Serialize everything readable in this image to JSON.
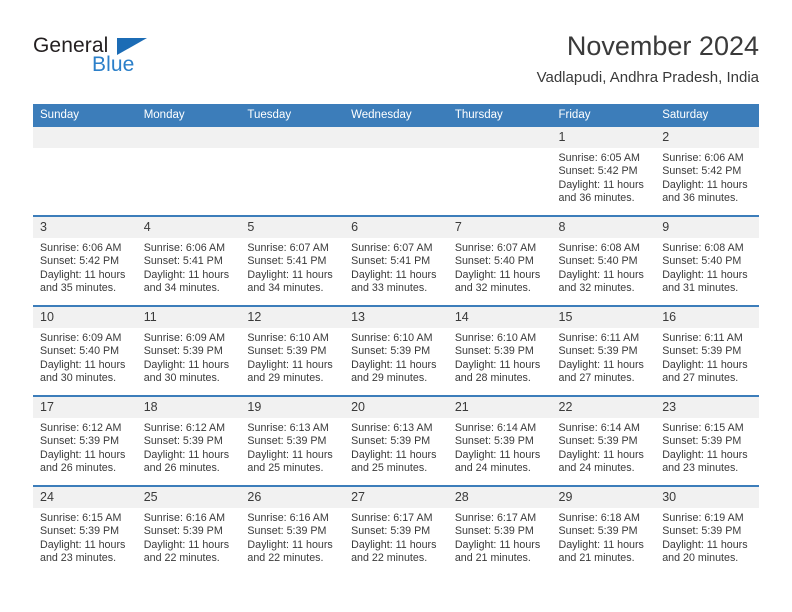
{
  "brand": {
    "name_part1": "General",
    "name_part2": "Blue",
    "accent_color": "#2b7fc9",
    "triangle_color": "#1c6cb5",
    "logo_icon": "triangle-icon"
  },
  "header": {
    "title": "November 2024",
    "location": "Vadlapudi, Andhra Pradesh, India"
  },
  "calendar": {
    "header_bg": "#3c7dba",
    "daynum_bg": "#f1f1f1",
    "weekday_headers": [
      "Sunday",
      "Monday",
      "Tuesday",
      "Wednesday",
      "Thursday",
      "Friday",
      "Saturday"
    ],
    "weeks": [
      [
        {
          "day": "",
          "empty": true
        },
        {
          "day": "",
          "empty": true
        },
        {
          "day": "",
          "empty": true
        },
        {
          "day": "",
          "empty": true
        },
        {
          "day": "",
          "empty": true
        },
        {
          "day": "1",
          "sunrise": "Sunrise: 6:05 AM",
          "sunset": "Sunset: 5:42 PM",
          "daylight": "Daylight: 11 hours and 36 minutes."
        },
        {
          "day": "2",
          "sunrise": "Sunrise: 6:06 AM",
          "sunset": "Sunset: 5:42 PM",
          "daylight": "Daylight: 11 hours and 36 minutes."
        }
      ],
      [
        {
          "day": "3",
          "sunrise": "Sunrise: 6:06 AM",
          "sunset": "Sunset: 5:42 PM",
          "daylight": "Daylight: 11 hours and 35 minutes."
        },
        {
          "day": "4",
          "sunrise": "Sunrise: 6:06 AM",
          "sunset": "Sunset: 5:41 PM",
          "daylight": "Daylight: 11 hours and 34 minutes."
        },
        {
          "day": "5",
          "sunrise": "Sunrise: 6:07 AM",
          "sunset": "Sunset: 5:41 PM",
          "daylight": "Daylight: 11 hours and 34 minutes."
        },
        {
          "day": "6",
          "sunrise": "Sunrise: 6:07 AM",
          "sunset": "Sunset: 5:41 PM",
          "daylight": "Daylight: 11 hours and 33 minutes."
        },
        {
          "day": "7",
          "sunrise": "Sunrise: 6:07 AM",
          "sunset": "Sunset: 5:40 PM",
          "daylight": "Daylight: 11 hours and 32 minutes."
        },
        {
          "day": "8",
          "sunrise": "Sunrise: 6:08 AM",
          "sunset": "Sunset: 5:40 PM",
          "daylight": "Daylight: 11 hours and 32 minutes."
        },
        {
          "day": "9",
          "sunrise": "Sunrise: 6:08 AM",
          "sunset": "Sunset: 5:40 PM",
          "daylight": "Daylight: 11 hours and 31 minutes."
        }
      ],
      [
        {
          "day": "10",
          "sunrise": "Sunrise: 6:09 AM",
          "sunset": "Sunset: 5:40 PM",
          "daylight": "Daylight: 11 hours and 30 minutes."
        },
        {
          "day": "11",
          "sunrise": "Sunrise: 6:09 AM",
          "sunset": "Sunset: 5:39 PM",
          "daylight": "Daylight: 11 hours and 30 minutes."
        },
        {
          "day": "12",
          "sunrise": "Sunrise: 6:10 AM",
          "sunset": "Sunset: 5:39 PM",
          "daylight": "Daylight: 11 hours and 29 minutes."
        },
        {
          "day": "13",
          "sunrise": "Sunrise: 6:10 AM",
          "sunset": "Sunset: 5:39 PM",
          "daylight": "Daylight: 11 hours and 29 minutes."
        },
        {
          "day": "14",
          "sunrise": "Sunrise: 6:10 AM",
          "sunset": "Sunset: 5:39 PM",
          "daylight": "Daylight: 11 hours and 28 minutes."
        },
        {
          "day": "15",
          "sunrise": "Sunrise: 6:11 AM",
          "sunset": "Sunset: 5:39 PM",
          "daylight": "Daylight: 11 hours and 27 minutes."
        },
        {
          "day": "16",
          "sunrise": "Sunrise: 6:11 AM",
          "sunset": "Sunset: 5:39 PM",
          "daylight": "Daylight: 11 hours and 27 minutes."
        }
      ],
      [
        {
          "day": "17",
          "sunrise": "Sunrise: 6:12 AM",
          "sunset": "Sunset: 5:39 PM",
          "daylight": "Daylight: 11 hours and 26 minutes."
        },
        {
          "day": "18",
          "sunrise": "Sunrise: 6:12 AM",
          "sunset": "Sunset: 5:39 PM",
          "daylight": "Daylight: 11 hours and 26 minutes."
        },
        {
          "day": "19",
          "sunrise": "Sunrise: 6:13 AM",
          "sunset": "Sunset: 5:39 PM",
          "daylight": "Daylight: 11 hours and 25 minutes."
        },
        {
          "day": "20",
          "sunrise": "Sunrise: 6:13 AM",
          "sunset": "Sunset: 5:39 PM",
          "daylight": "Daylight: 11 hours and 25 minutes."
        },
        {
          "day": "21",
          "sunrise": "Sunrise: 6:14 AM",
          "sunset": "Sunset: 5:39 PM",
          "daylight": "Daylight: 11 hours and 24 minutes."
        },
        {
          "day": "22",
          "sunrise": "Sunrise: 6:14 AM",
          "sunset": "Sunset: 5:39 PM",
          "daylight": "Daylight: 11 hours and 24 minutes."
        },
        {
          "day": "23",
          "sunrise": "Sunrise: 6:15 AM",
          "sunset": "Sunset: 5:39 PM",
          "daylight": "Daylight: 11 hours and 23 minutes."
        }
      ],
      [
        {
          "day": "24",
          "sunrise": "Sunrise: 6:15 AM",
          "sunset": "Sunset: 5:39 PM",
          "daylight": "Daylight: 11 hours and 23 minutes."
        },
        {
          "day": "25",
          "sunrise": "Sunrise: 6:16 AM",
          "sunset": "Sunset: 5:39 PM",
          "daylight": "Daylight: 11 hours and 22 minutes."
        },
        {
          "day": "26",
          "sunrise": "Sunrise: 6:16 AM",
          "sunset": "Sunset: 5:39 PM",
          "daylight": "Daylight: 11 hours and 22 minutes."
        },
        {
          "day": "27",
          "sunrise": "Sunrise: 6:17 AM",
          "sunset": "Sunset: 5:39 PM",
          "daylight": "Daylight: 11 hours and 22 minutes."
        },
        {
          "day": "28",
          "sunrise": "Sunrise: 6:17 AM",
          "sunset": "Sunset: 5:39 PM",
          "daylight": "Daylight: 11 hours and 21 minutes."
        },
        {
          "day": "29",
          "sunrise": "Sunrise: 6:18 AM",
          "sunset": "Sunset: 5:39 PM",
          "daylight": "Daylight: 11 hours and 21 minutes."
        },
        {
          "day": "30",
          "sunrise": "Sunrise: 6:19 AM",
          "sunset": "Sunset: 5:39 PM",
          "daylight": "Daylight: 11 hours and 20 minutes."
        }
      ]
    ]
  }
}
